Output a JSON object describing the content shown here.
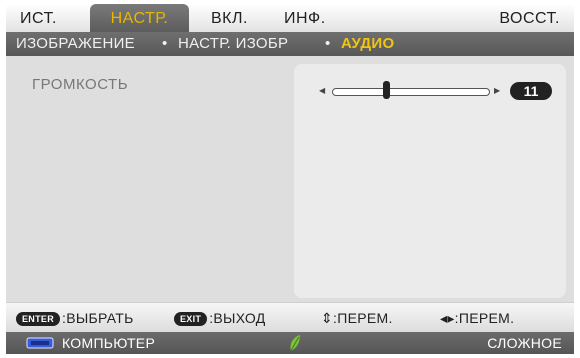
{
  "tabs": [
    {
      "label": "ИСТ."
    },
    {
      "label": "НАСТР.",
      "active": true
    },
    {
      "label": "ВКЛ."
    },
    {
      "label": "ИНФ."
    },
    {
      "label": "ВОССТ."
    }
  ],
  "breadcrumb": {
    "items": [
      "ИЗОБРАЖЕНИЕ",
      "НАСТР. ИЗОБР",
      "АУДИО"
    ],
    "separator": "•",
    "active_color": "#f1c40f"
  },
  "volume": {
    "label": "ГРОМКОСТЬ",
    "value": "11",
    "level_fraction": 0.35
  },
  "help": {
    "select_key": "ENTER",
    "select_label": ":ВЫБРАТЬ",
    "exit_key": "EXIT",
    "exit_label": ":ВЫХОД",
    "updown_label": "⇕:ПЕРЕМ.",
    "leftright_label": "◂▸:ПЕРЕМ."
  },
  "status": {
    "source_icon": "computer-monitor-icon",
    "source": "КОМПЬЮТЕР",
    "eco_icon": "eco-leaf-icon",
    "mode": "СЛОЖНОЕ"
  },
  "colors": {
    "active_tab_text": "#e6b800",
    "eco_leaf": "#7cc23a"
  }
}
